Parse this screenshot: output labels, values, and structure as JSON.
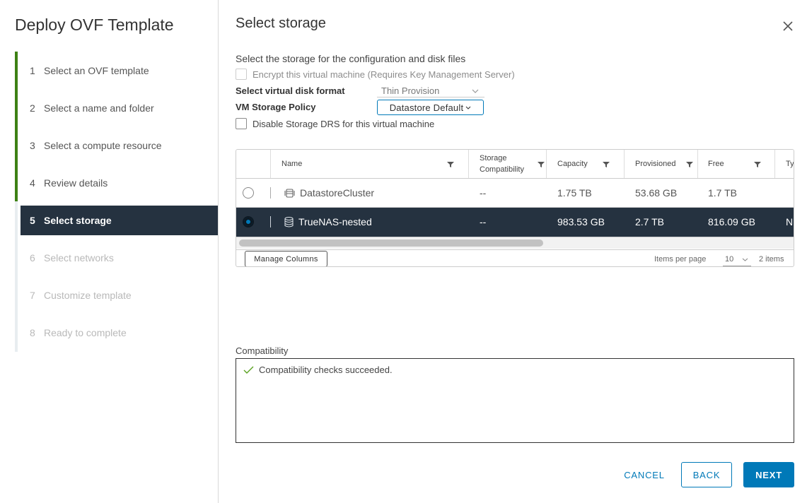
{
  "wizard": {
    "title": "Deploy OVF Template",
    "steps": [
      {
        "num": "1",
        "label": "Select an OVF template",
        "state": "done"
      },
      {
        "num": "2",
        "label": "Select a name and folder",
        "state": "done"
      },
      {
        "num": "3",
        "label": "Select a compute resource",
        "state": "done"
      },
      {
        "num": "4",
        "label": "Review details",
        "state": "done"
      },
      {
        "num": "5",
        "label": "Select storage",
        "state": "active"
      },
      {
        "num": "6",
        "label": "Select networks",
        "state": "disabled"
      },
      {
        "num": "7",
        "label": "Customize template",
        "state": "disabled"
      },
      {
        "num": "8",
        "label": "Ready to complete",
        "state": "disabled"
      }
    ]
  },
  "page": {
    "title": "Select storage",
    "intro": "Select the storage for the configuration and disk files",
    "encrypt_label": "Encrypt this virtual machine (Requires Key Management Server)",
    "disk_format_label": "Select virtual disk format",
    "disk_format_value": "Thin Provision",
    "policy_label": "VM Storage Policy",
    "policy_value": "Datastore Default",
    "drs_label": "Disable Storage DRS for this virtual machine"
  },
  "grid": {
    "columns": {
      "name": "Name",
      "compat_line1": "Storage",
      "compat_line2": "Compatibility",
      "capacity": "Capacity",
      "provisioned": "Provisioned",
      "free": "Free",
      "type": "Ty"
    },
    "rows": [
      {
        "name": "DatastoreCluster",
        "compat": "--",
        "capacity": "1.75 TB",
        "provisioned": "53.68 GB",
        "free": "1.7 TB",
        "type": "",
        "selected": false
      },
      {
        "name": "TrueNAS-nested",
        "compat": "--",
        "capacity": "983.53 GB",
        "provisioned": "2.7 TB",
        "free": "816.09 GB",
        "type": "N",
        "selected": true
      }
    ],
    "manage_columns": "Manage Columns",
    "items_per_page_label": "Items per page",
    "items_per_page_value": "10",
    "item_count": "2 items"
  },
  "compatibility": {
    "label": "Compatibility",
    "message": "Compatibility checks succeeded."
  },
  "buttons": {
    "cancel": "CANCEL",
    "back": "BACK",
    "next": "NEXT"
  },
  "colors": {
    "accent": "#0079b8",
    "selected_bg": "#253240",
    "progress": "#3d8114",
    "success": "#5aa220"
  }
}
